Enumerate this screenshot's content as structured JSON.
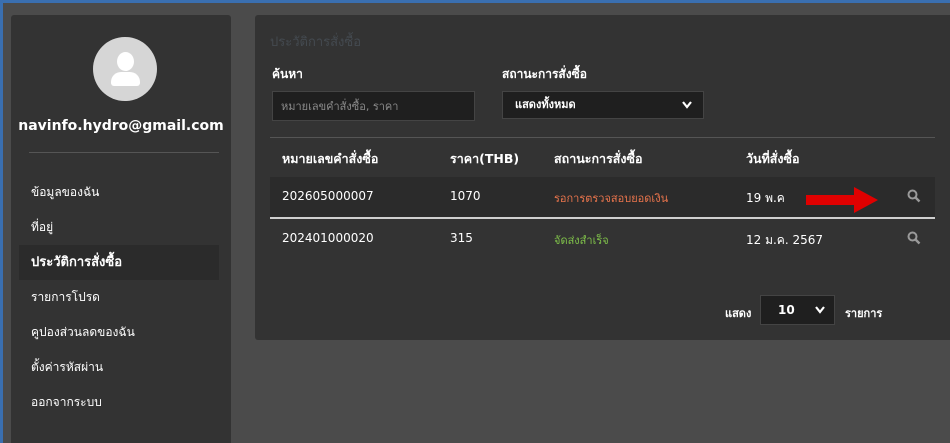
{
  "sidebar": {
    "email": "navinfo.hydro@gmail.com",
    "items": [
      {
        "label": "ข้อมูลของฉัน"
      },
      {
        "label": "ที่อยู่"
      },
      {
        "label": "ประวัติการสั่งซื้อ"
      },
      {
        "label": "รายการโปรด"
      },
      {
        "label": "คูปองส่วนลดของฉัน"
      },
      {
        "label": "ตั้งค่ารหัสผ่าน"
      },
      {
        "label": "ออกจากระบบ"
      }
    ],
    "active_index": 2
  },
  "main": {
    "title": "ประวัติการสั่งซื้อ",
    "search": {
      "label": "ค้นหา",
      "placeholder": "หมายเลขคำสั่งซื้อ, ราคา",
      "value": ""
    },
    "status_filter": {
      "label": "สถานะการสั่งซื้อ",
      "selected": "แสดงทั้งหมด"
    },
    "table": {
      "headers": [
        "หมายเลขคำสั่งซื้อ",
        "ราคา(THB)",
        "สถานะการสั่งซื้อ",
        "วันที่สั่งซื้อ"
      ],
      "rows": [
        {
          "order": "202605000007",
          "price": "1070",
          "status": "รอการตรวจสอบยอดเงิน",
          "date": "19 พ.ค"
        },
        {
          "order": "202401000020",
          "price": "315",
          "status": "จัดส่งสำเร็จ",
          "date": "12 ม.ค. 2567"
        }
      ]
    },
    "pager": {
      "show_label": "แสดง",
      "per_page": "10",
      "items_label": "รายการ"
    }
  },
  "colors": {
    "status_pending": "#e8744c",
    "status_done": "#7fc04a",
    "arrow": "#e00000",
    "panel_bg": "#333333",
    "page_bg": "#4b4b4b"
  },
  "icons": [
    "user-avatar-icon",
    "search-icon",
    "chevron-down-icon",
    "red-arrow-annotation"
  ]
}
